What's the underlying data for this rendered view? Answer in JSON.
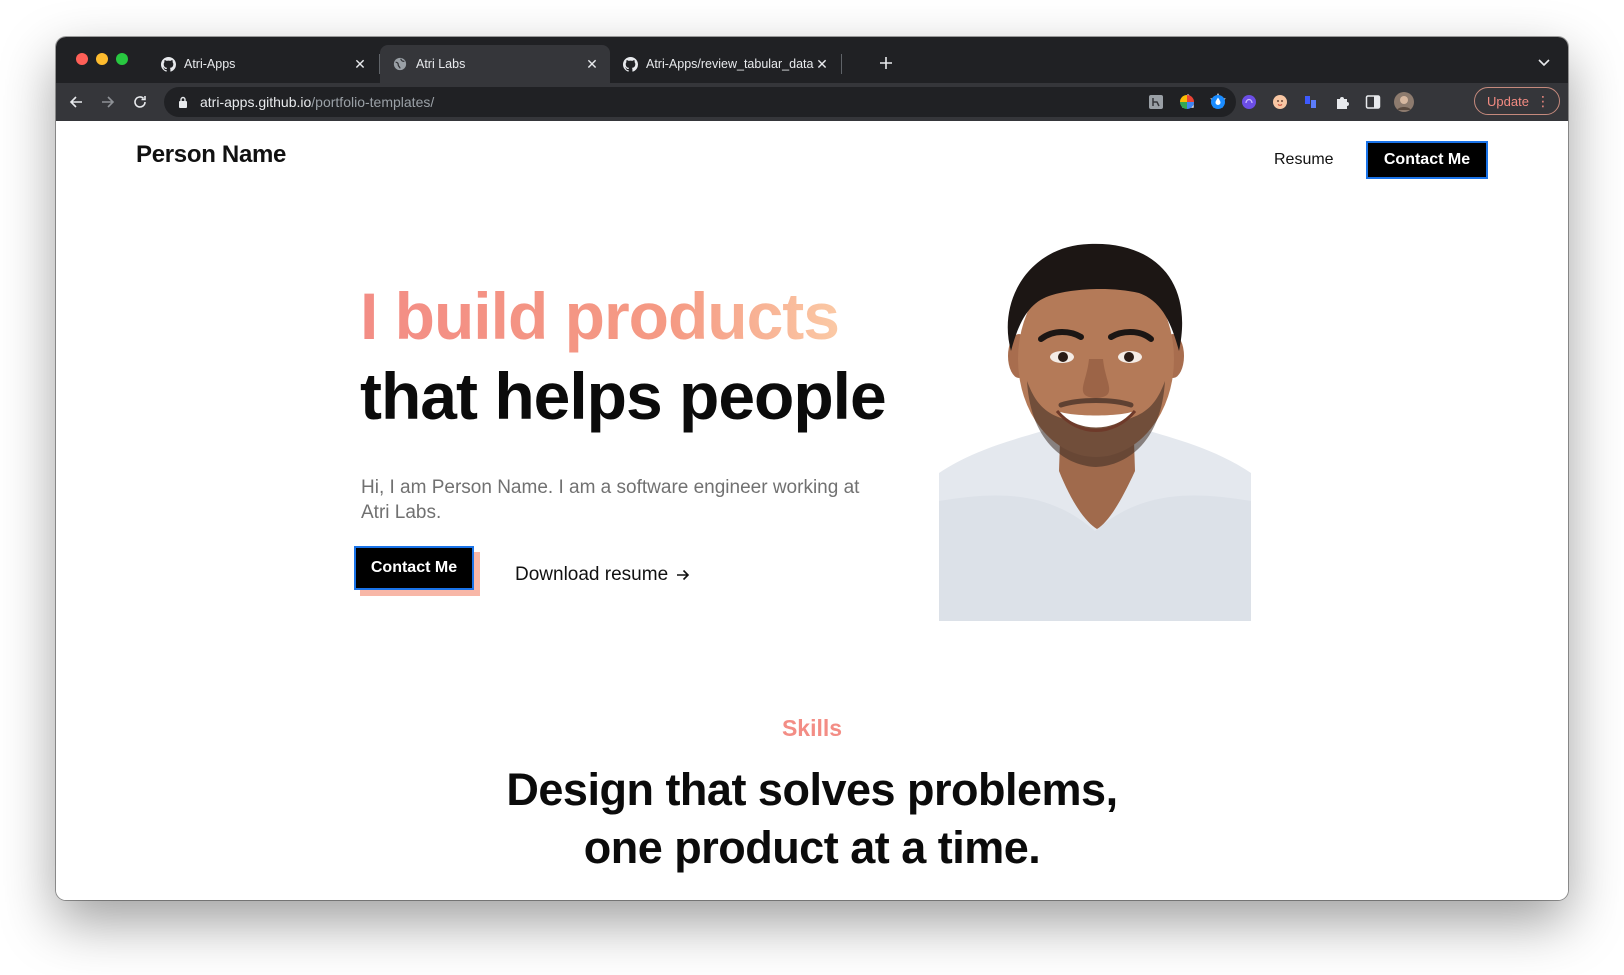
{
  "browser": {
    "tabs": [
      {
        "title": "Atri-Apps",
        "favicon": "github-icon",
        "active": false
      },
      {
        "title": "Atri Labs",
        "favicon": "globe-icon",
        "active": true
      },
      {
        "title": "Atri-Apps/review_tabular_data",
        "favicon": "github-icon",
        "active": false
      }
    ],
    "url_host": "atri-apps.github.io",
    "url_path": "/portfolio-templates/",
    "update_label": "Update",
    "colors": {
      "tabstrip": "#202124",
      "toolbar": "#35363a",
      "update": "#f28b82"
    }
  },
  "site": {
    "brand": "Person Name",
    "nav": {
      "resume": "Resume",
      "contact": "Contact Me"
    },
    "hero": {
      "line1": "I build products",
      "line2": "that helps people",
      "intro": "Hi, I am Person Name. I am a software engineer working at Atri Labs.",
      "cta": "Contact Me",
      "download": "Download resume"
    },
    "skills": {
      "eyebrow": "Skills",
      "title_line1": "Design that solves problems,",
      "title_line2": "one product at a time."
    },
    "colors": {
      "accent": "#f38d85",
      "accent_light": "#fbc9a5",
      "cta_shadow": "#f8b7a7",
      "text": "#0b0b0b"
    }
  }
}
